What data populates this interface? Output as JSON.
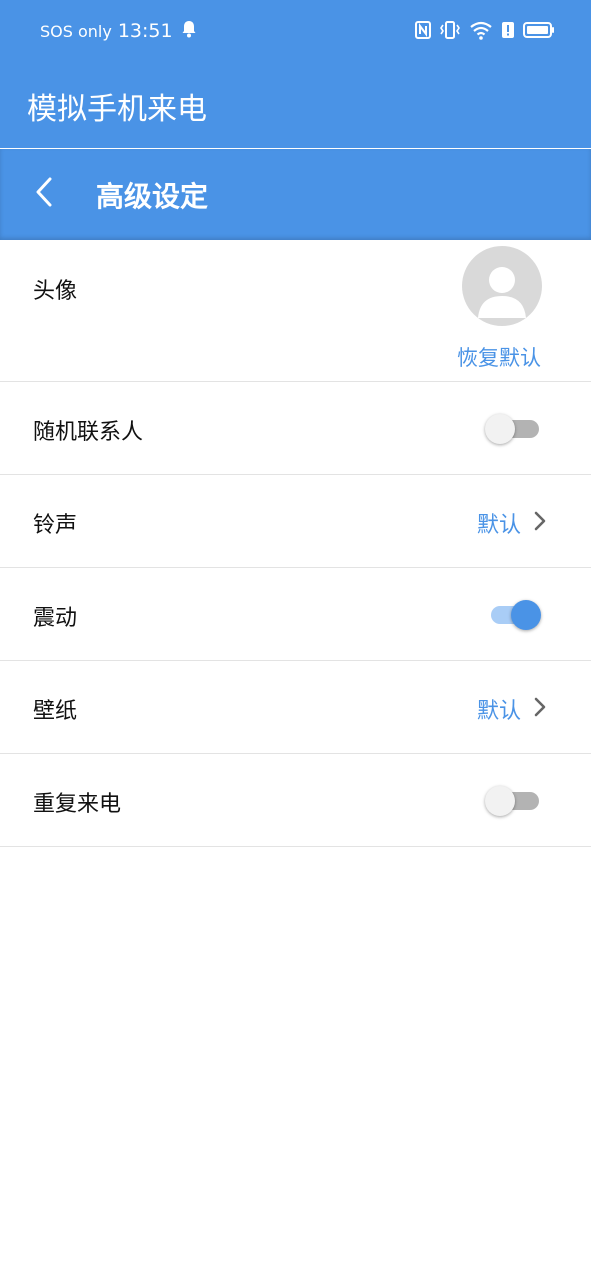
{
  "status_bar": {
    "carrier": "SOS only",
    "time": "13:51",
    "icons": [
      "bell-icon",
      "nfc-icon",
      "vibrate-icon",
      "wifi-icon",
      "alert-icon",
      "battery-icon"
    ]
  },
  "app": {
    "title": "模拟手机来电"
  },
  "sub_header": {
    "title": "高级设定"
  },
  "settings": {
    "avatar": {
      "label": "头像",
      "restore_label": "恢复默认"
    },
    "random_contact": {
      "label": "随机联系人",
      "enabled": false
    },
    "ringtone": {
      "label": "铃声",
      "value": "默认"
    },
    "vibration": {
      "label": "震动",
      "enabled": true
    },
    "wallpaper": {
      "label": "壁纸",
      "value": "默认"
    },
    "repeat_call": {
      "label": "重复来电",
      "enabled": false
    }
  },
  "colors": {
    "primary": "#4a93e6",
    "divider": "#e3e3e3",
    "avatar_bg": "#d9d9d9"
  }
}
